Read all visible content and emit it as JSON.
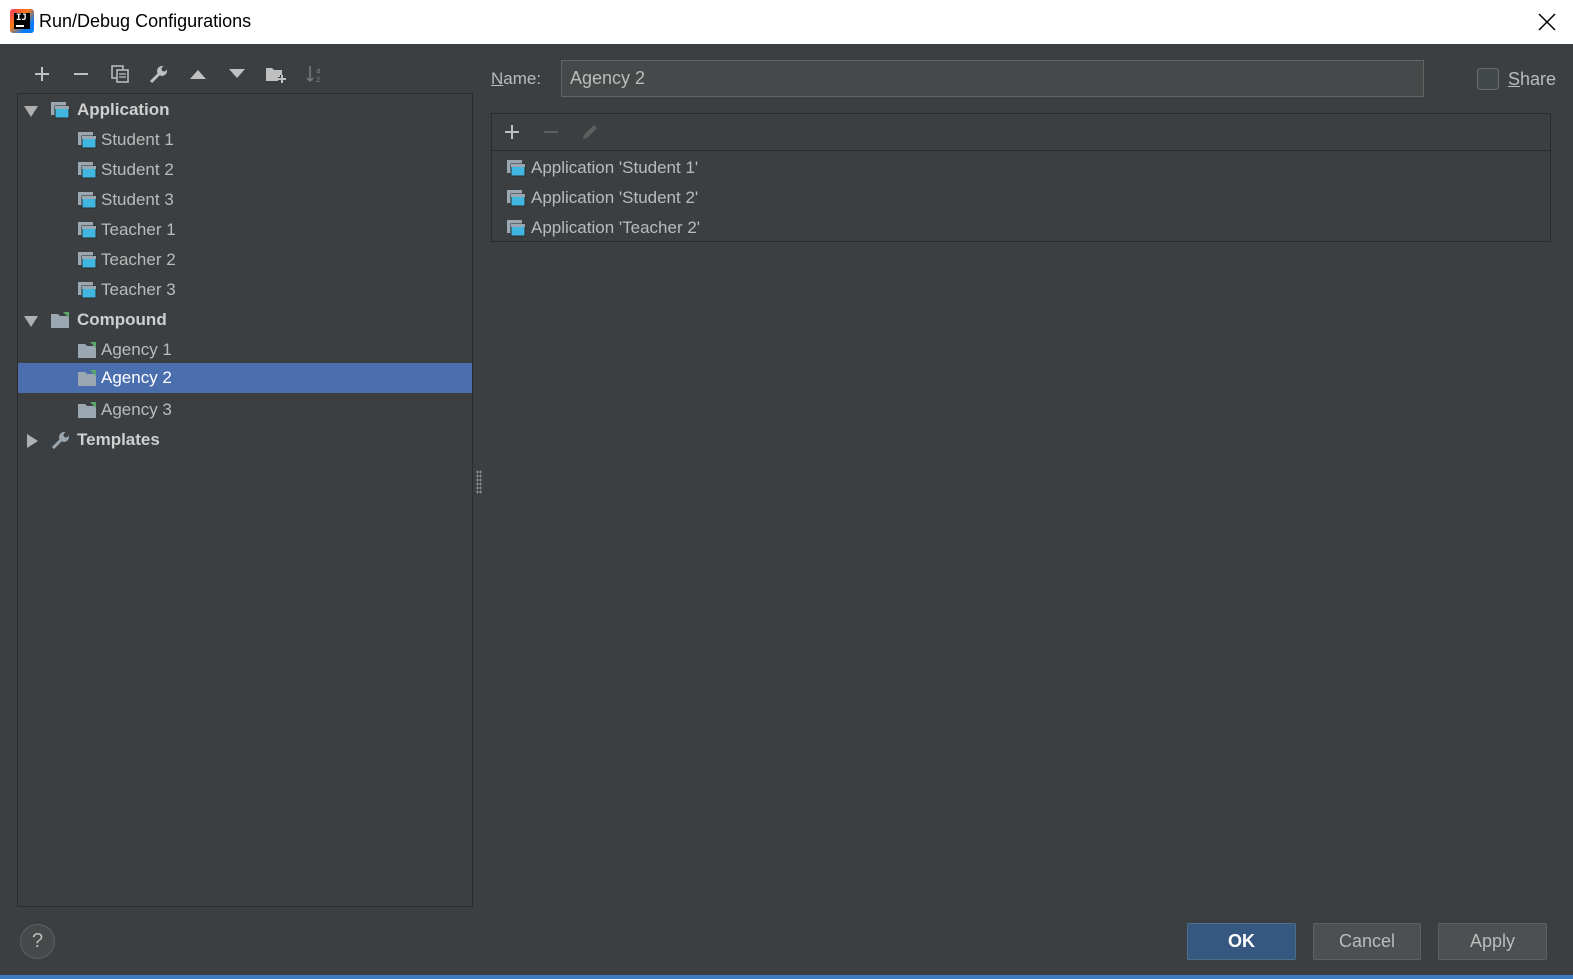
{
  "window": {
    "title": "Run/Debug Configurations"
  },
  "toolbar": {
    "icons": [
      "add-icon",
      "remove-icon",
      "copy-icon",
      "wrench-icon",
      "move-up-icon",
      "move-down-icon",
      "new-folder-icon",
      "sort-icon"
    ]
  },
  "tree": {
    "application": {
      "label": "Application",
      "items": [
        "Student 1",
        "Student 2",
        "Student 3",
        "Teacher 1",
        "Teacher 2",
        "Teacher 3"
      ]
    },
    "compound": {
      "label": "Compound",
      "items": [
        "Agency 1",
        "Agency 2",
        "Agency 3"
      ],
      "selected": "Agency 2"
    },
    "templates": {
      "label": "Templates"
    }
  },
  "form": {
    "name_label_accel": "N",
    "name_label_rest": "ame:",
    "name_value": "Agency 2",
    "share_accel": "S",
    "share_rest": "hare"
  },
  "compound_configs": [
    "Application 'Student 1'",
    "Application 'Student 2'",
    "Application 'Teacher 2'"
  ],
  "buttons": {
    "help": "?",
    "ok": "OK",
    "cancel": "Cancel",
    "apply": "Apply"
  },
  "colors": {
    "background": "#3c3f41",
    "selection": "#4b6eaf",
    "ok_button": "#365880",
    "accent_line": "#3d7cc0"
  }
}
